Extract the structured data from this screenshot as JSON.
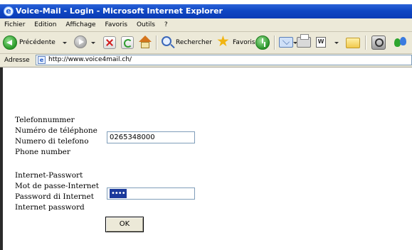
{
  "window": {
    "title": "Voice-Mail - Login - Microsoft Internet Explorer"
  },
  "menu": {
    "items": [
      "Fichier",
      "Edition",
      "Affichage",
      "Favoris",
      "Outils",
      "?"
    ]
  },
  "toolbar": {
    "back_label": "Précédente",
    "search_label": "Rechercher",
    "favorites_label": "Favoris"
  },
  "address": {
    "label": "Adresse",
    "url": "http://www.voice4mail.ch/"
  },
  "form": {
    "phone_labels": [
      "Telefonnummer",
      "Numéro de téléphone",
      "Numero di telefono",
      "Phone number"
    ],
    "phone_value": "0265348000",
    "password_labels": [
      "Internet-Passwort",
      "Mot de passe-Internet",
      "Password di Internet",
      "Internet password"
    ],
    "password_mask": "••••",
    "ok_label": "OK"
  }
}
